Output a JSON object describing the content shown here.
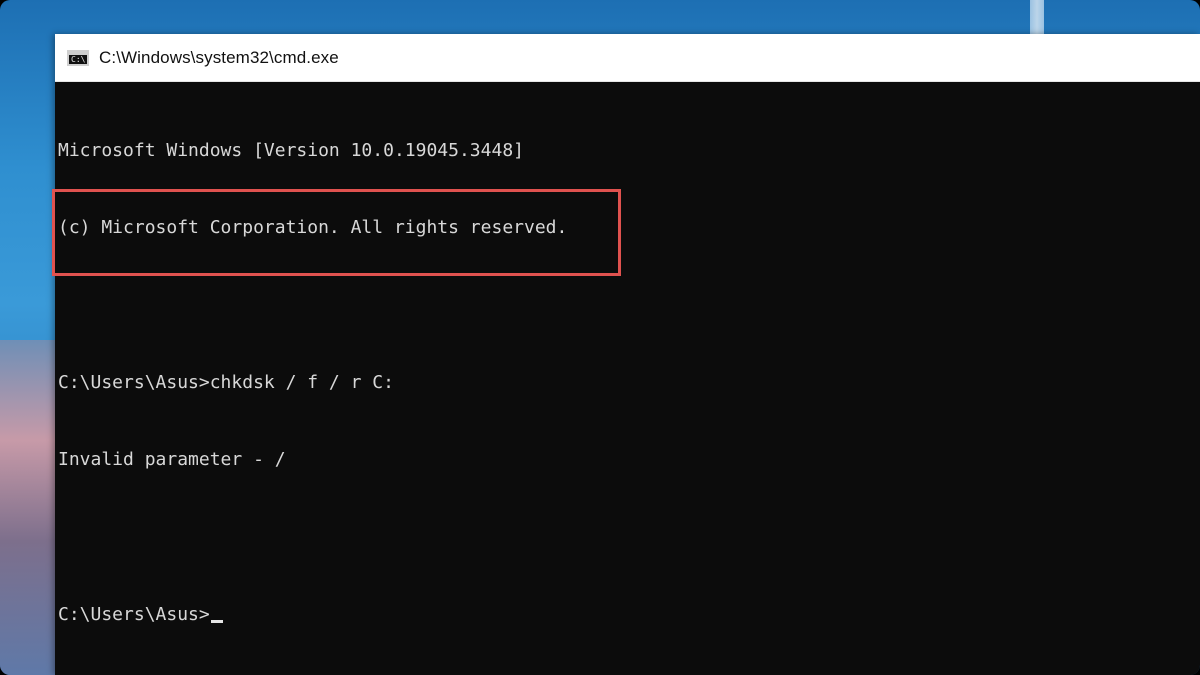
{
  "window": {
    "title": "C:\\Windows\\system32\\cmd.exe",
    "icon": "cmd-icon",
    "icon_text": "C:\\"
  },
  "console": {
    "header_line1": "Microsoft Windows [Version 10.0.19045.3448]",
    "header_line2": "(c) Microsoft Corporation. All rights reserved.",
    "command_line": "C:\\Users\\Asus>chkdsk / f / r C:",
    "error_line": "Invalid parameter - /",
    "prompt_line": "C:\\Users\\Asus>"
  },
  "colors": {
    "console_background": "#0c0c0c",
    "console_text": "#d8d8d8",
    "highlight_border": "#e0524f",
    "titlebar_background": "#ffffff"
  }
}
